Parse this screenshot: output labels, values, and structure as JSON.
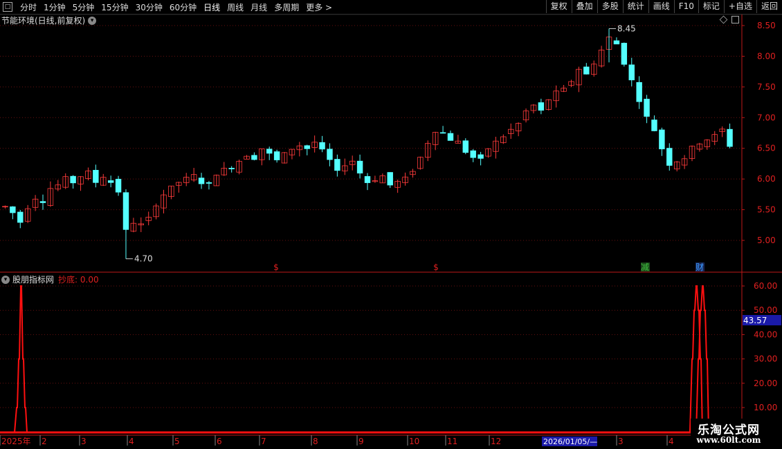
{
  "toolbar": {
    "periods": [
      "分时",
      "1分钟",
      "5分钟",
      "15分钟",
      "30分钟",
      "60分钟",
      "日线",
      "周线",
      "月线",
      "多周期",
      "更多 >"
    ],
    "active_period": "日线",
    "right_buttons": [
      "复权",
      "叠加",
      "多股",
      "统计",
      "画线",
      "F10",
      "标记",
      "+自选",
      "返回"
    ]
  },
  "main_chart": {
    "title": "节能环境(日线,前复权)",
    "y_ticks": [
      "8.50",
      "8.00",
      "7.50",
      "7.00",
      "6.50",
      "6.00",
      "5.50",
      "5.00"
    ],
    "high_label": "8.45",
    "low_label": "4.70",
    "markers": [
      {
        "text": "$",
        "color": "#e02020"
      },
      {
        "text": "$",
        "color": "#e02020"
      },
      {
        "text": "减",
        "color": "#40c040"
      },
      {
        "text": "财",
        "color": "#3a9aff"
      }
    ]
  },
  "sub_chart": {
    "name": "股朋指标网",
    "indicator": "抄底: 0.00",
    "y_ticks": [
      "60.00",
      "50.00",
      "40.00",
      "30.00",
      "20.00",
      "10.00"
    ],
    "cursor_value": "43.57"
  },
  "x_axis": {
    "labels": [
      "2025年",
      "2",
      "3",
      "4",
      "5",
      "6",
      "7",
      "8",
      "9",
      "10",
      "11",
      "12",
      "3",
      "4"
    ],
    "cursor_date": "2026/01/05/—"
  },
  "logo": {
    "line1": "乐淘公式网",
    "line2": "www.60lt.com"
  },
  "colors": {
    "up": "#ff3b3b",
    "down": "#54ffff",
    "axis": "#c01818",
    "indicator": "#ff1010"
  },
  "chart_data": {
    "type": "candlestick",
    "price_range": [
      4.7,
      8.45
    ],
    "high": 8.45,
    "low": 4.7,
    "indicator_name": "抄底",
    "indicator_value": 0.0,
    "indicator_ylim": [
      0,
      60
    ],
    "indicator_spikes": [
      {
        "position": "start",
        "values": [
          10,
          30,
          60
        ]
      },
      {
        "position": "end",
        "values": [
          30,
          50,
          60,
          50,
          60,
          30
        ]
      }
    ],
    "trend_close": [
      5.55,
      5.45,
      5.3,
      5.55,
      5.7,
      5.65,
      5.85,
      5.9,
      6.0,
      5.95,
      6.05,
      6.1,
      5.95,
      6.05,
      5.95,
      5.8,
      5.15,
      5.3,
      5.25,
      5.35,
      5.6,
      5.75,
      5.85,
      5.95,
      6.0,
      6.05,
      5.95,
      5.9,
      6.1,
      6.15,
      6.2,
      6.3,
      6.4,
      6.35,
      6.5,
      6.4,
      6.3,
      6.4,
      6.5,
      6.55,
      6.5,
      6.6,
      6.45,
      6.3,
      6.1,
      6.25,
      6.3,
      6.1,
      5.95,
      6.0,
      6.05,
      5.9,
      5.95,
      6.0,
      6.15,
      6.35,
      6.6,
      6.8,
      6.75,
      6.65,
      6.6,
      6.45,
      6.35,
      6.3,
      6.5,
      6.6,
      6.7,
      6.8,
      6.9,
      7.1,
      7.2,
      7.1,
      7.3,
      7.4,
      7.45,
      7.6,
      7.8,
      7.7,
      7.9,
      8.1,
      8.3,
      8.2,
      7.9,
      7.6,
      7.3,
      7.0,
      6.8,
      6.5,
      6.25,
      6.3,
      6.35,
      6.5,
      6.6,
      6.65,
      6.7,
      6.8,
      6.55
    ]
  }
}
